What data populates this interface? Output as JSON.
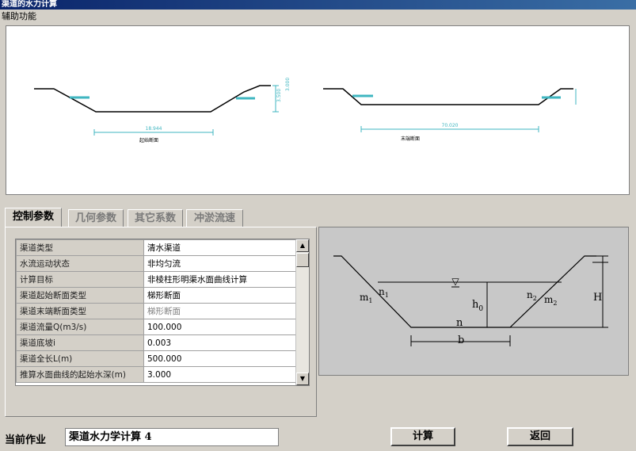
{
  "window": {
    "title": "渠道的水力计算"
  },
  "menu": {
    "items": [
      "辅助功能"
    ]
  },
  "preview": {
    "left": {
      "caption": "起始断面",
      "width_label": "18.944",
      "depth_label": "3.000",
      "height_label": "3.500"
    },
    "right": {
      "caption": "末端断面",
      "width_label": "70.020",
      "depth_label": "",
      "height_label": ""
    }
  },
  "tabs": [
    {
      "label": "控制参数",
      "active": true
    },
    {
      "label": "几何参数",
      "active": false
    },
    {
      "label": "其它系数",
      "active": false
    },
    {
      "label": "冲淤流速",
      "active": false
    }
  ],
  "params": {
    "rows": [
      {
        "key": "渠道类型",
        "value": "清水渠道",
        "disabled": false
      },
      {
        "key": "水流运动状态",
        "value": "非均匀流",
        "disabled": false
      },
      {
        "key": "计算目标",
        "value": "非棱柱形明渠水面曲线计算",
        "disabled": false
      },
      {
        "key": "渠道起始断面类型",
        "value": "梯形断面",
        "disabled": false
      },
      {
        "key": "渠道末端断面类型",
        "value": "梯形断面",
        "disabled": true
      },
      {
        "key": "渠道流量Q(m3/s)",
        "value": "100.000",
        "disabled": false
      },
      {
        "key": "渠道底坡i",
        "value": "0.003",
        "disabled": false
      },
      {
        "key": "渠道全长L(m)",
        "value": "500.000",
        "disabled": false
      },
      {
        "key": "推算水面曲线的起始水深(m)",
        "value": "3.000",
        "disabled": false
      }
    ]
  },
  "diagram": {
    "m1": "m",
    "m1_sub": "1",
    "n1": "n",
    "n1_sub": "1",
    "n2": "n",
    "n2_sub": "2",
    "m2": "m",
    "m2_sub": "2",
    "h0": "h",
    "h0_sub": "0",
    "n_bottom": "n",
    "b": "b",
    "H": "H",
    "water_symbol": "▽"
  },
  "footer": {
    "job_label": "当前作业",
    "job_value": "渠道水力学计算 4",
    "calc_button": "计算",
    "back_button": "返回"
  }
}
